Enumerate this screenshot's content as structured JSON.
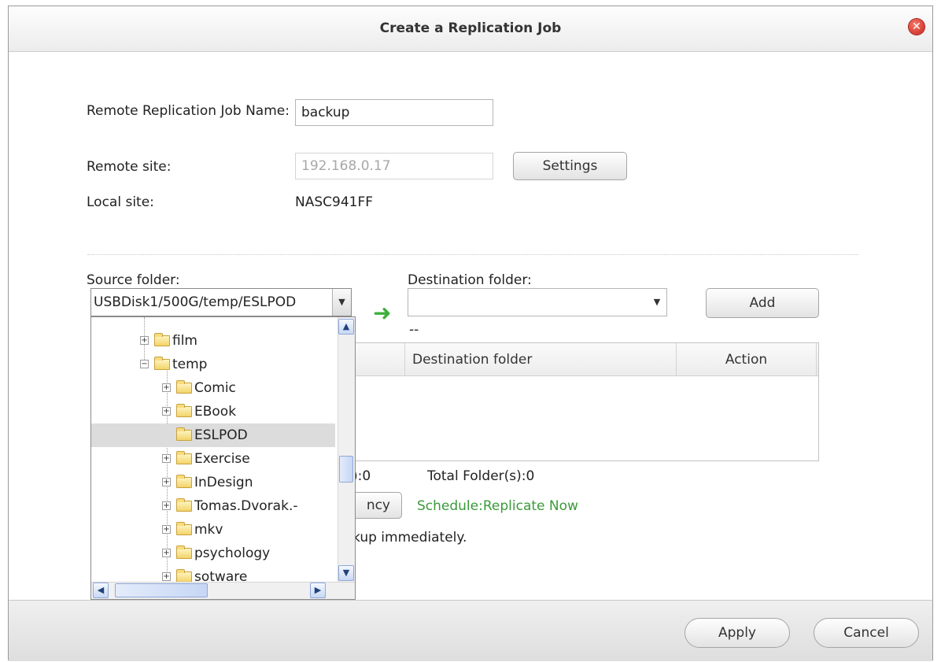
{
  "dialog": {
    "title": "Create a Replication Job",
    "close_icon": "close-icon"
  },
  "form": {
    "job_name_label": "Remote Replication Job Name:",
    "job_name_value": "backup",
    "remote_site_label": "Remote site:",
    "remote_site_value": "192.168.0.17",
    "settings_button": "Settings",
    "local_site_label": "Local site:",
    "local_site_value": "NASC941FF"
  },
  "folders": {
    "source_label": "Source folder:",
    "source_value": "USBDisk1/500G/temp/ESLPOD",
    "destination_label": "Destination folder:",
    "destination_value": "",
    "destination_hint": "--",
    "add_button": "Add"
  },
  "table": {
    "columns": [
      "Destination folder",
      "Action"
    ]
  },
  "summary": {
    "partial_count": "):0",
    "total_folders": "Total Folder(s):0",
    "frequency_button_partial": "ncy",
    "schedule_text": "Schedule:Replicate Now",
    "note_partial": "kup immediately."
  },
  "tree": {
    "items": [
      {
        "label": "film",
        "level": 2,
        "expandable": true,
        "open": false,
        "selected": false
      },
      {
        "label": "temp",
        "level": 2,
        "expandable": true,
        "open": true,
        "selected": false
      },
      {
        "label": "Comic",
        "level": 3,
        "expandable": true,
        "open": false,
        "selected": false
      },
      {
        "label": "EBook",
        "level": 3,
        "expandable": true,
        "open": false,
        "selected": false
      },
      {
        "label": "ESLPOD",
        "level": 3,
        "expandable": false,
        "open": false,
        "selected": true
      },
      {
        "label": "Exercise",
        "level": 3,
        "expandable": true,
        "open": false,
        "selected": false
      },
      {
        "label": "InDesign",
        "level": 3,
        "expandable": true,
        "open": false,
        "selected": false
      },
      {
        "label": "Tomas.Dvorak.-",
        "level": 3,
        "expandable": true,
        "open": false,
        "selected": false
      },
      {
        "label": "mkv",
        "level": 3,
        "expandable": true,
        "open": false,
        "selected": false
      },
      {
        "label": "psychology",
        "level": 3,
        "expandable": true,
        "open": false,
        "selected": false
      },
      {
        "label": "sotware",
        "level": 3,
        "expandable": true,
        "open": false,
        "selected": false
      }
    ]
  },
  "footer": {
    "apply_button": "Apply",
    "cancel_button": "Cancel"
  },
  "colors": {
    "schedule_text": "#3a9a3a",
    "arrow": "#3ab03a",
    "close_button": "#d4271f"
  }
}
